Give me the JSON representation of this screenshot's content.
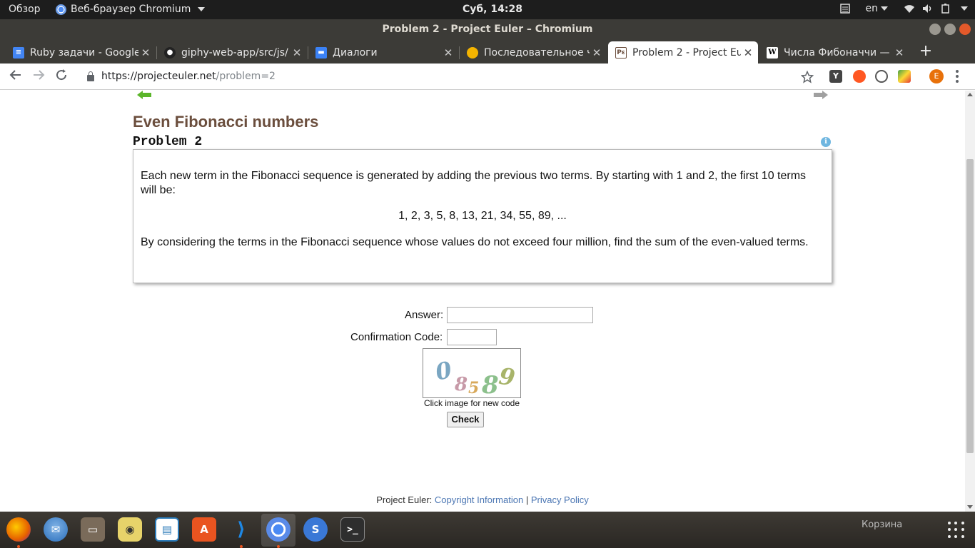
{
  "topbar": {
    "activities": "Обзор",
    "app_menu": "Веб-браузер Chromium",
    "clock": "Суб, 14:28",
    "lang": "en"
  },
  "window": {
    "title": "Problem 2 - Project Euler – Chromium"
  },
  "tabs": [
    {
      "label": "Ruby задачи - Google",
      "icon": "google-docs-icon",
      "color": "#4285f4"
    },
    {
      "label": "giphy-web-app/src/js/",
      "icon": "github-icon",
      "color": "#111111"
    },
    {
      "label": "Диалоги",
      "icon": "chat-icon",
      "color": "#3b82f6"
    },
    {
      "label": "Последовательное ч",
      "icon": "circle-icon",
      "color": "#f4b400"
    },
    {
      "label": "Problem 2 - Project Eu",
      "icon": "project-euler-icon",
      "color": "#6b4e3d"
    },
    {
      "label": "Числа Фибоначчи —",
      "icon": "wikipedia-icon",
      "color": "#ffffff"
    }
  ],
  "new_tab": "+",
  "address": {
    "host": "https://projecteuler.net",
    "path": "/problem=2"
  },
  "extensions": [
    {
      "label": "Y",
      "color": "#444444"
    },
    {
      "label": "",
      "color": "#ff5722"
    },
    {
      "label": "",
      "color": "#555555"
    },
    {
      "label": "",
      "color": "#43a047"
    }
  ],
  "profile_initial": "E",
  "page": {
    "title": "Even Fibonacci numbers",
    "problem_number": "Problem 2",
    "info": "i",
    "paragraph1": "Each new term in the Fibonacci sequence is generated by adding the previous two terms. By starting with 1 and 2, the first 10 terms will be:",
    "sequence": "1, 2, 3, 5, 8, 13, 21, 34, 55, 89, ...",
    "paragraph2": "By considering the terms in the Fibonacci sequence whose values do not exceed four million, find the sum of the even-valued terms.",
    "answer_label": "Answer:",
    "answer_value": "",
    "confirm_label": "Confirmation Code:",
    "confirm_value": "",
    "captcha_digits": [
      "0",
      "8",
      "5",
      "8",
      "9"
    ],
    "captcha_caption": "Click image for new code",
    "check_button": "Check",
    "footer_prefix": "Project Euler:",
    "footer_copyright": "Copyright Information",
    "footer_sep": "|",
    "footer_privacy": "Privacy Policy"
  },
  "dock": {
    "trash_label": "Корзина",
    "apps": [
      {
        "name": "firefox-icon",
        "color": "#e66000"
      },
      {
        "name": "thunderbird-icon",
        "color": "#2a6ebb"
      },
      {
        "name": "files-icon",
        "color": "#7a6b5a"
      },
      {
        "name": "rhythmbox-icon",
        "color": "#e7d36a"
      },
      {
        "name": "libreoffice-writer-icon",
        "color": "#2a7ab8"
      },
      {
        "name": "software-center-icon",
        "color": "#e95420"
      },
      {
        "name": "vscode-icon",
        "color": "#1e88e5"
      },
      {
        "name": "chromium-icon",
        "color": "#5a8be8"
      },
      {
        "name": "simplenote-icon",
        "color": "#3a78d6"
      },
      {
        "name": "terminal-icon",
        "color": "#2e2e2e"
      }
    ]
  }
}
